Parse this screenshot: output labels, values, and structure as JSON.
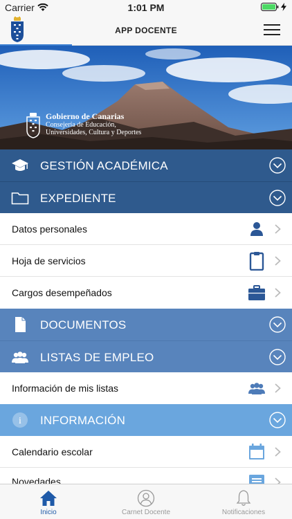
{
  "status_bar": {
    "carrier": "Carrier",
    "time": "1:01 PM"
  },
  "header": {
    "title": "APP DOCENTE",
    "menu_icon": "hamburger-menu-icon",
    "logo_icon": "canarias-crest-icon"
  },
  "banner": {
    "org_name": "Gobierno de Canarias",
    "org_line1": "Consejería de Educación,",
    "org_line2": "Universidades, Cultura y Deportes"
  },
  "sections": {
    "gestion": {
      "label": "GESTIÓN ACADÉMICA",
      "icon": "graduation-cap-icon",
      "color": "#2f5a8d"
    },
    "expediente": {
      "label": "EXPEDIENTE",
      "icon": "folder-icon",
      "color": "#2f5a8d",
      "items": [
        {
          "label": "Datos personales",
          "icon": "person-icon"
        },
        {
          "label": "Hoja de servicios",
          "icon": "clipboard-icon"
        },
        {
          "label": "Cargos desempeñados",
          "icon": "briefcase-icon"
        }
      ]
    },
    "documentos": {
      "label": "DOCUMENTOS",
      "icon": "document-icon",
      "color": "#5884bc"
    },
    "listas": {
      "label": "LISTAS DE EMPLEO",
      "icon": "users-icon",
      "color": "#5884bc",
      "items": [
        {
          "label": "Información de mis listas",
          "icon": "group-icon"
        }
      ]
    },
    "informacion": {
      "label": "INFORMACIÓN",
      "icon": "info-icon",
      "color": "#6aa6de",
      "items": [
        {
          "label": "Calendario escolar",
          "icon": "calendar-icon"
        },
        {
          "label": "Novedades",
          "icon": "news-icon"
        }
      ]
    }
  },
  "tab_bar": {
    "tabs": [
      {
        "label": "Inicio",
        "icon": "home-icon",
        "active": true
      },
      {
        "label": "Carnet Docente",
        "icon": "id-user-icon",
        "active": false
      },
      {
        "label": "Notificaciones",
        "icon": "bell-icon",
        "active": false
      }
    ]
  }
}
